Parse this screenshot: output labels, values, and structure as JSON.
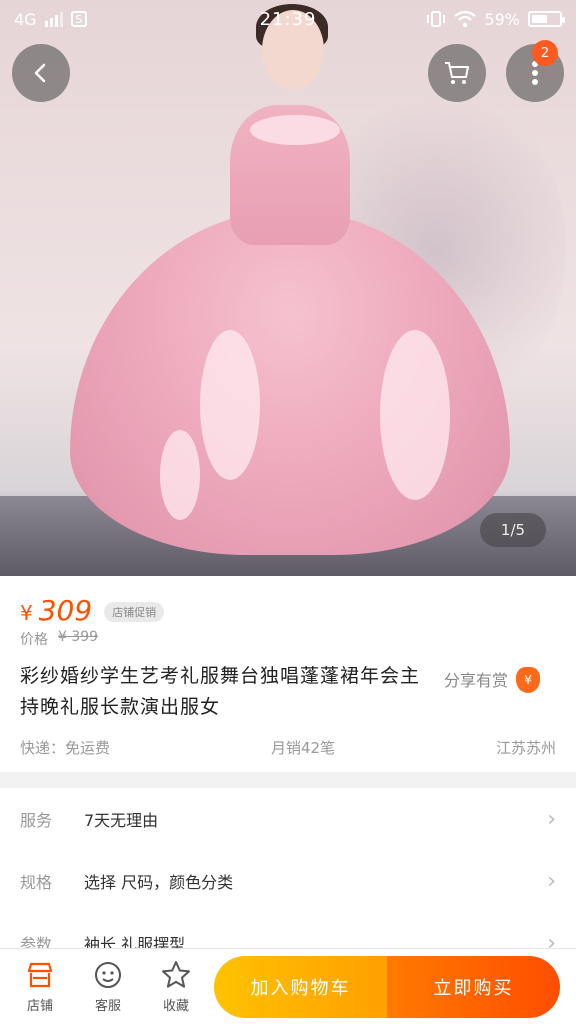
{
  "status_bar": {
    "network": "4G",
    "time": "21:39",
    "battery": "59%",
    "battery_level": 0.59
  },
  "hero": {
    "pager": "1/5",
    "more_badge": "2",
    "back_icon": "back-chevron-icon",
    "cart_icon": "shopping-cart-icon",
    "more_icon": "more-dots-icon"
  },
  "product": {
    "currency": "¥",
    "price": "309",
    "price_tag": "店铺促销",
    "orig_label": "价格",
    "orig_price": "¥ 399",
    "title": "彩纱婚纱学生艺考礼服舞台独唱蓬蓬裙年会主持晚礼服长款演出服女",
    "share_label": "分享有赏",
    "share_icon_glyph": "¥",
    "shipping": "快递：免运费",
    "monthly_sales": "月销42笔",
    "location": "江苏苏州"
  },
  "options": [
    {
      "label": "服务",
      "value": "7天无理由"
    },
    {
      "label": "规格",
      "value": "选择 尺码，颜色分类"
    },
    {
      "label": "参数",
      "value": "袖长 礼服摆型"
    }
  ],
  "bottom_bar": {
    "store_label": "店铺",
    "service_label": "客服",
    "favorite_label": "收藏",
    "add_to_cart": "加入购物车",
    "buy_now": "立即购买"
  },
  "colors": {
    "accent": "#ff5000",
    "cart_button": "#ffb000",
    "buy_button": "#ff5a00"
  }
}
